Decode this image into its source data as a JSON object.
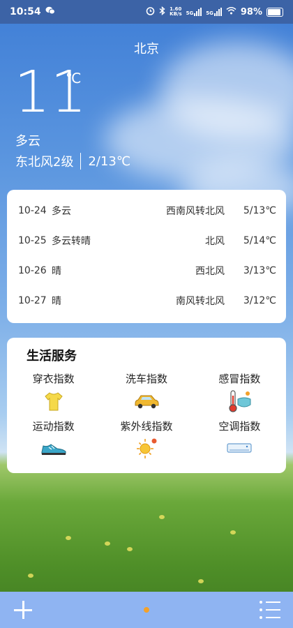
{
  "status_bar": {
    "time": "10:54",
    "net_speed_top": "1.60",
    "net_speed_unit": "KB/s",
    "sig1_label": "5G",
    "sig2_label": "5G",
    "battery": "98%",
    "battery_level": 0.98,
    "icons": [
      "wechat-icon",
      "alarm-icon",
      "bluetooth-icon",
      "signal-icon",
      "wifi-icon",
      "battery-icon"
    ]
  },
  "current": {
    "city": "北京",
    "temperature": "11",
    "unit": "℃",
    "weather": "多云",
    "wind": "东北风2级",
    "range": "2/13℃"
  },
  "forecast": [
    {
      "date": "10-24",
      "weather": "多云",
      "wind": "西南风转北风",
      "range": "5/13℃"
    },
    {
      "date": "10-25",
      "weather": "多云转晴",
      "wind": "北风",
      "range": "5/14℃"
    },
    {
      "date": "10-26",
      "weather": "晴",
      "wind": "西北风",
      "range": "3/13℃"
    },
    {
      "date": "10-27",
      "weather": "晴",
      "wind": "南风转北风",
      "range": "3/12℃"
    }
  ],
  "life": {
    "title": "生活服务",
    "items": [
      {
        "label": "穿衣指数",
        "icon": "tshirt-icon"
      },
      {
        "label": "洗车指数",
        "icon": "car-icon"
      },
      {
        "label": "感冒指数",
        "icon": "thermometer-mask-icon"
      },
      {
        "label": "运动指数",
        "icon": "sneaker-icon"
      },
      {
        "label": "紫外线指数",
        "icon": "sun-icon"
      },
      {
        "label": "空调指数",
        "icon": "air-conditioner-icon"
      }
    ]
  },
  "bottom_bar": {
    "add_icon": "plus-icon",
    "menu_icon": "list-menu-icon",
    "page_indicator_color": "#f3a12a"
  }
}
